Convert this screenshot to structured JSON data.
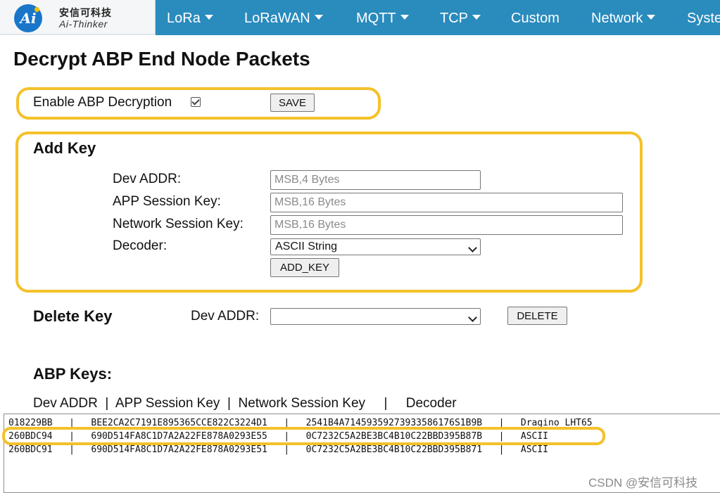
{
  "brand": {
    "logo_mark": "Ai",
    "name_cn": "安信可科技",
    "name_en": "Ai-Thinker"
  },
  "nav": {
    "items": [
      {
        "label": "LoRa",
        "dropdown": true
      },
      {
        "label": "LoRaWAN",
        "dropdown": true
      },
      {
        "label": "MQTT",
        "dropdown": true
      },
      {
        "label": "TCP",
        "dropdown": true
      },
      {
        "label": "Custom",
        "dropdown": false
      },
      {
        "label": "Network",
        "dropdown": true
      },
      {
        "label": "Syste",
        "dropdown": false
      }
    ]
  },
  "page": {
    "title": "Decrypt ABP End Node Packets"
  },
  "enable": {
    "label": "Enable ABP Decryption",
    "checked": true,
    "save_label": "SAVE"
  },
  "add_key": {
    "heading": "Add Key",
    "dev_addr_label": "Dev ADDR:",
    "dev_addr_placeholder": "MSB,4 Bytes",
    "app_key_label": "APP Session Key:",
    "app_key_placeholder": "MSB,16 Bytes",
    "nwk_key_label": "Network Session Key:",
    "nwk_key_placeholder": "MSB,16 Bytes",
    "decoder_label": "Decoder:",
    "decoder_value": "ASCII String",
    "add_button": "ADD_KEY"
  },
  "delete_key": {
    "heading": "Delete Key",
    "dev_addr_label": "Dev ADDR:",
    "dev_addr_value": "",
    "delete_button": "DELETE"
  },
  "abp_keys": {
    "heading": "ABP Keys:",
    "header_line": "Dev ADDR  |  APP Session Key  |  Network Session Key     |     Decoder",
    "rows": [
      "018229BB   |   BEE2CA2C7191E895365CCE822C3224D1   |   2541B4A71459359273933586176S1B9B   |   Dragino_LHT65",
      "260BDC94   |   690D514FA8C1D7A2A22FE878A0293E55   |   0C7232C5A2BE3BC4B10C22BBD395B87B   |   ASCII",
      "260BDC91   |   690D514FA8C1D7A2A22FE878A0293E51   |   0C7232C5A2BE3BC4B10C22BBD395B871   |   ASCII"
    ]
  },
  "watermark": "CSDN @安信可科技",
  "colors": {
    "navbar": "#2a8bbd",
    "highlight": "#f5c12a",
    "logo_blue": "#1976c9"
  }
}
